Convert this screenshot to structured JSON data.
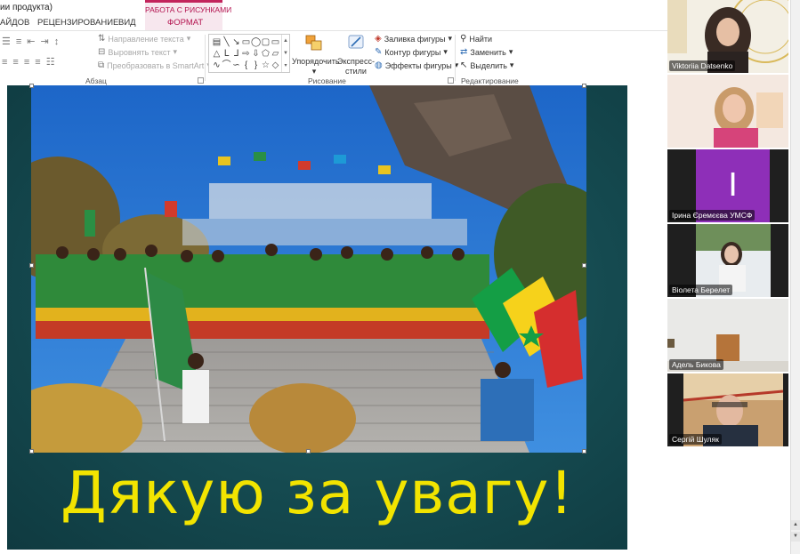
{
  "ribbon": {
    "title_partial": "ии продукта)",
    "context_group": "РАБОТА С РИСУНКАМИ",
    "tabs": [
      "АЙДОВ",
      "РЕЦЕНЗИРОВАНИЕ",
      "ВИД",
      "ФОРМАТ"
    ],
    "paragraph": {
      "label": "Абзац",
      "text_direction": "Направление текста",
      "align_text": "Выровнять текст",
      "convert_smartart": "Преобразовать в SmartArt"
    },
    "drawing": {
      "label": "Рисование",
      "arrange": "Упорядочить",
      "quick_styles_1": "Экспресс-",
      "quick_styles_2": "стили",
      "shape_fill": "Заливка фигуры",
      "shape_outline": "Контур фигуры",
      "shape_effects": "Эффекты фигуры"
    },
    "editing": {
      "label": "Редактирование",
      "find": "Найти",
      "replace": "Заменить",
      "select": "Выделить"
    }
  },
  "slide": {
    "thanks_text": "Дякую за увагу!",
    "text_color": "#f2e400",
    "background_color": "#154a50"
  },
  "participants": [
    {
      "name": "Viktoriia Datsenko"
    },
    {
      "name": ""
    },
    {
      "name": "Ірина Єремєєва УМСФ",
      "avatar_letter": "I",
      "avatar_color": "#8e2fb8"
    },
    {
      "name": "Віолета Берелет"
    },
    {
      "name": "Адель Бикова"
    },
    {
      "name": "Сергій Шуляк"
    }
  ]
}
